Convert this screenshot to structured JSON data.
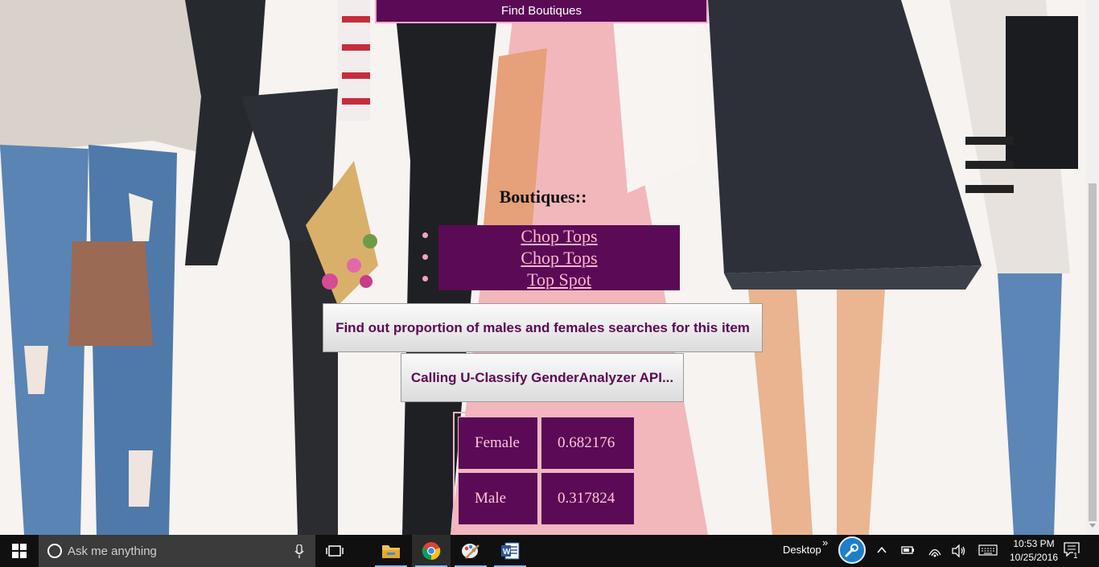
{
  "top_button": {
    "label": "Find Boutiques"
  },
  "boutiques": {
    "heading": "Boutiques::",
    "items": [
      "Chop Tops",
      "Chop Tops",
      "Top Spot"
    ]
  },
  "actions": {
    "proportion_label": "Find out proportion of males and females searches for this item",
    "api_label": "Calling U-Classify GenderAnalyzer API..."
  },
  "results": [
    {
      "label": "Female",
      "value": "0.682176"
    },
    {
      "label": "Male",
      "value": "0.317824"
    }
  ],
  "colors": {
    "accent": "#5b0a55",
    "link": "#ffb6cf",
    "border_pink": "#f3b4c9",
    "taskbar": "#101010"
  },
  "taskbar": {
    "search_placeholder": "Ask me anything",
    "pinned": [
      "file-explorer-icon",
      "chrome-icon",
      "paint-icon",
      "word-icon"
    ],
    "desktop_label": "Desktop",
    "time": "10:53 PM",
    "date": "10/25/2016",
    "notification_count": "1"
  }
}
